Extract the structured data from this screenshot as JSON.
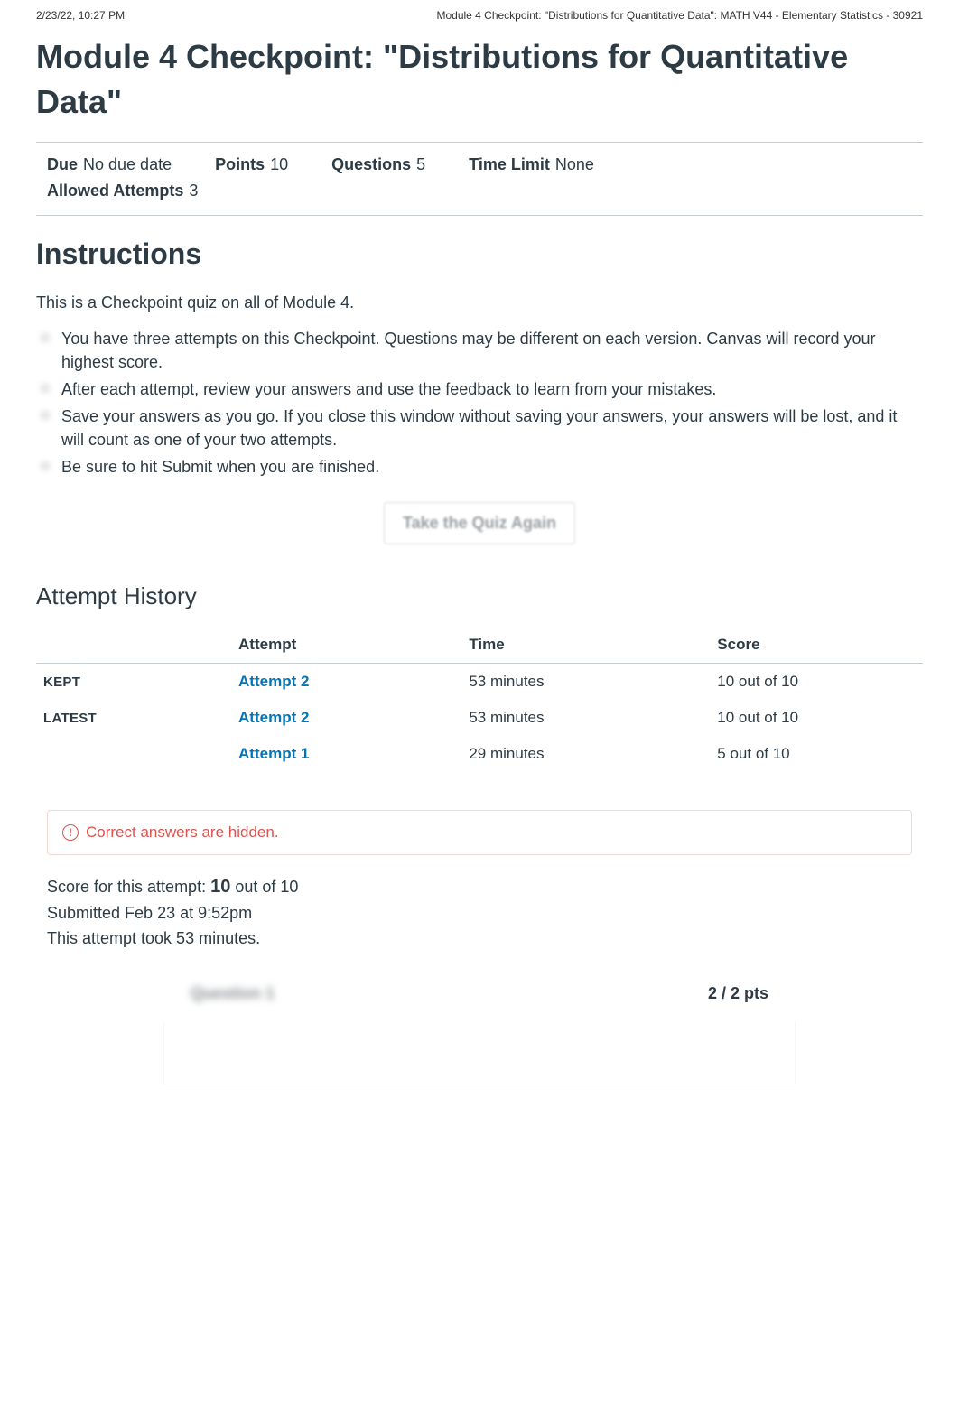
{
  "print_header": {
    "left": "2/23/22, 10:27 PM",
    "right": "Module 4 Checkpoint: \"Distributions for Quantitative Data\": MATH V44 - Elementary Statistics - 30921"
  },
  "page_title": "Module 4 Checkpoint: \"Distributions for Quantitative Data\"",
  "meta": {
    "due_label": "Due",
    "due_value": "No due date",
    "points_label": "Points",
    "points_value": "10",
    "questions_label": "Questions",
    "questions_value": "5",
    "time_limit_label": "Time Limit",
    "time_limit_value": "None",
    "allowed_label": "Allowed Attempts",
    "allowed_value": "3"
  },
  "instructions": {
    "heading": "Instructions",
    "intro": "This is a Checkpoint quiz on all of Module 4.",
    "bullets": [
      "You have three attempts on this Checkpoint. Questions may be different on each version. Canvas will record your highest score.",
      "After each attempt, review your answers and use the feedback to learn from your mistakes.",
      "Save your answers as you go. If you close this window without saving your answers, your answers will be lost, and it will count as one of your two attempts.",
      "Be sure to hit Submit when you are finished."
    ]
  },
  "take_button": "Take the Quiz Again",
  "history": {
    "heading": "Attempt History",
    "headers": {
      "blank": "",
      "attempt": "Attempt",
      "time": "Time",
      "score": "Score"
    },
    "rows": [
      {
        "label": "KEPT",
        "attempt": "Attempt 2",
        "time": "53 minutes",
        "score": "10 out of 10"
      },
      {
        "label": "LATEST",
        "attempt": "Attempt 2",
        "time": "53 minutes",
        "score": "10 out of 10"
      },
      {
        "label": "",
        "attempt": "Attempt 1",
        "time": "29 minutes",
        "score": "5 out of 10"
      }
    ]
  },
  "alert": {
    "text": "Correct answers are hidden."
  },
  "summary": {
    "score_prefix": "Score for this attempt: ",
    "score_value": "10",
    "score_suffix": " out of 10",
    "submitted": "Submitted Feb 23 at 9:52pm",
    "duration": "This attempt took 53 minutes."
  },
  "question": {
    "label_blurred": "Question 1",
    "points": "2 / 2 pts"
  }
}
